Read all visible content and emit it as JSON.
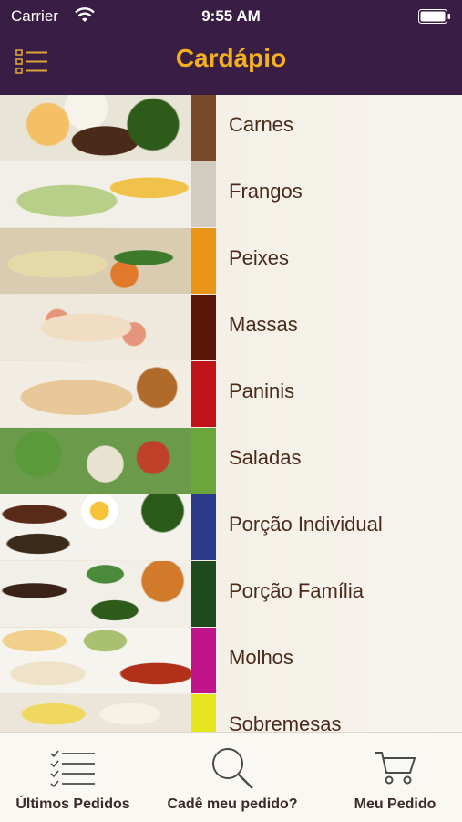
{
  "status_bar": {
    "carrier": "Carrier",
    "time": "9:55 AM"
  },
  "header": {
    "title": "Cardápio"
  },
  "categories": [
    {
      "label": "Carnes",
      "color": "#7a4a2a"
    },
    {
      "label": "Frangos",
      "color": "#d3ccc1"
    },
    {
      "label": "Peixes",
      "color": "#e8951a"
    },
    {
      "label": "Massas",
      "color": "#5a1408"
    },
    {
      "label": "Paninis",
      "color": "#c0141a"
    },
    {
      "label": "Saladas",
      "color": "#6aa63a"
    },
    {
      "label": "Porção Individual",
      "color": "#2c3a8a"
    },
    {
      "label": "Porção Família",
      "color": "#1e4a1e"
    },
    {
      "label": "Molhos",
      "color": "#c0148a"
    },
    {
      "label": "Sobremesas",
      "color": "#e6e61e"
    }
  ],
  "tabbar": {
    "tabs": [
      {
        "label": "Últimos Pedidos",
        "icon": "checklist-icon"
      },
      {
        "label": "Cadê meu pedido?",
        "icon": "search-icon"
      },
      {
        "label": "Meu Pedido",
        "icon": "cart-icon"
      }
    ]
  },
  "colors": {
    "header_bg": "#3a1d44",
    "title_accent": "#f2b01e"
  }
}
